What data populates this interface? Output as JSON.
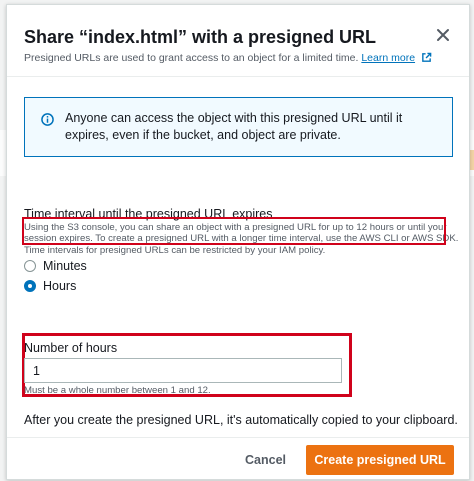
{
  "dialog": {
    "title": "Share “index.html” with a presigned URL",
    "subtitle": "Presigned URLs are used to grant access to an object for a limited time.",
    "learn_more": "Learn more"
  },
  "info": {
    "text": "Anyone can access the object with this presigned URL until it expires, even if the bucket, and object are private."
  },
  "time_interval": {
    "label": "Time interval until the presigned URL expires",
    "description_line1": "Using the S3 console, you can share an object with a presigned URL for up to 12 hours or until your",
    "description_line2": "session expires. To create a presigned URL with a longer time interval, use the AWS CLI or AWS SDK.",
    "description_line3": "Time intervals for presigned URLs can be restricted by your IAM policy.",
    "options": [
      {
        "label": "Minutes",
        "selected": false
      },
      {
        "label": "Hours",
        "selected": true
      }
    ]
  },
  "hours": {
    "label": "Number of hours",
    "value": "1",
    "hint": "Must be a whole number between 1 and 12."
  },
  "clipboard_note": "After you create the presigned URL, it's automatically copied to your clipboard.",
  "footer": {
    "cancel_label": "Cancel",
    "create_label": "Create presigned URL"
  },
  "colors": {
    "primary": "#ec7211",
    "link": "#0073bb",
    "highlight": "#d0021b",
    "info_bg": "#f1faff"
  },
  "icons": [
    "close-icon",
    "info-icon",
    "external-link-icon"
  ]
}
